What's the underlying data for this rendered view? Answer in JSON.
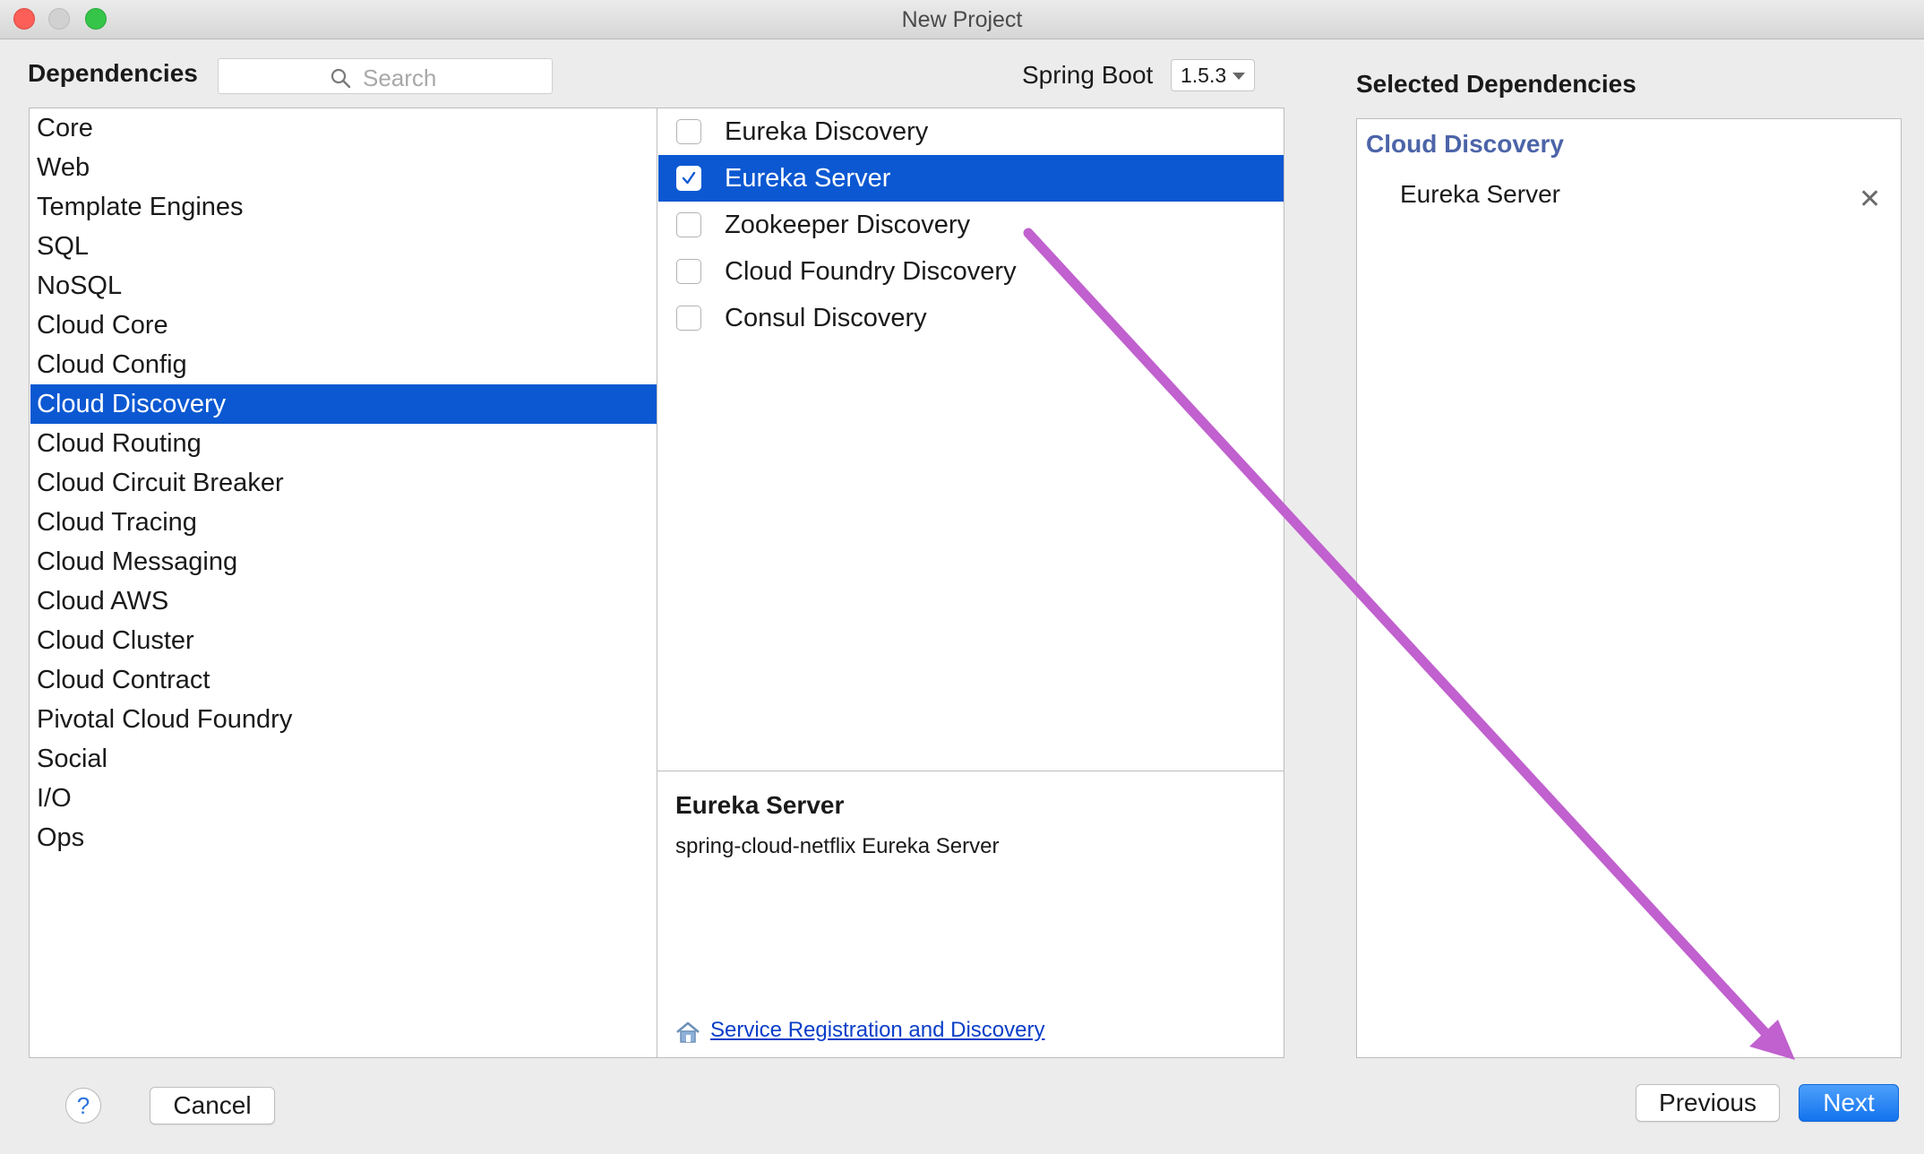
{
  "window": {
    "title": "New Project"
  },
  "header": {
    "dependencies_label": "Dependencies",
    "search_placeholder": "Search",
    "spring_boot_label": "Spring Boot",
    "spring_boot_version": "1.5.3",
    "selected_label": "Selected Dependencies"
  },
  "categories": {
    "items": [
      {
        "label": "Core"
      },
      {
        "label": "Web"
      },
      {
        "label": "Template Engines"
      },
      {
        "label": "SQL"
      },
      {
        "label": "NoSQL"
      },
      {
        "label": "Cloud Core"
      },
      {
        "label": "Cloud Config"
      },
      {
        "label": "Cloud Discovery"
      },
      {
        "label": "Cloud Routing"
      },
      {
        "label": "Cloud Circuit Breaker"
      },
      {
        "label": "Cloud Tracing"
      },
      {
        "label": "Cloud Messaging"
      },
      {
        "label": "Cloud AWS"
      },
      {
        "label": "Cloud Cluster"
      },
      {
        "label": "Cloud Contract"
      },
      {
        "label": "Pivotal Cloud Foundry"
      },
      {
        "label": "Social"
      },
      {
        "label": "I/O"
      },
      {
        "label": "Ops"
      }
    ],
    "selected_index": 7
  },
  "dependencies": {
    "items": [
      {
        "label": "Eureka Discovery",
        "checked": false
      },
      {
        "label": "Eureka Server",
        "checked": true
      },
      {
        "label": "Zookeeper Discovery",
        "checked": false
      },
      {
        "label": "Cloud Foundry Discovery",
        "checked": false
      },
      {
        "label": "Consul Discovery",
        "checked": false
      }
    ],
    "selected_index": 1
  },
  "description": {
    "title": "Eureka Server",
    "text": "spring-cloud-netflix Eureka Server",
    "link_label": "Service Registration and Discovery"
  },
  "selected": {
    "group": "Cloud Discovery",
    "items": [
      {
        "label": "Eureka Server"
      }
    ],
    "remove_glyph": "✕"
  },
  "buttons": {
    "help": "?",
    "cancel": "Cancel",
    "previous": "Previous",
    "next": "Next"
  },
  "colors": {
    "selection": "#0b58d2",
    "annotation_arrow": "#c160cf",
    "group_heading": "#4c64a8"
  }
}
